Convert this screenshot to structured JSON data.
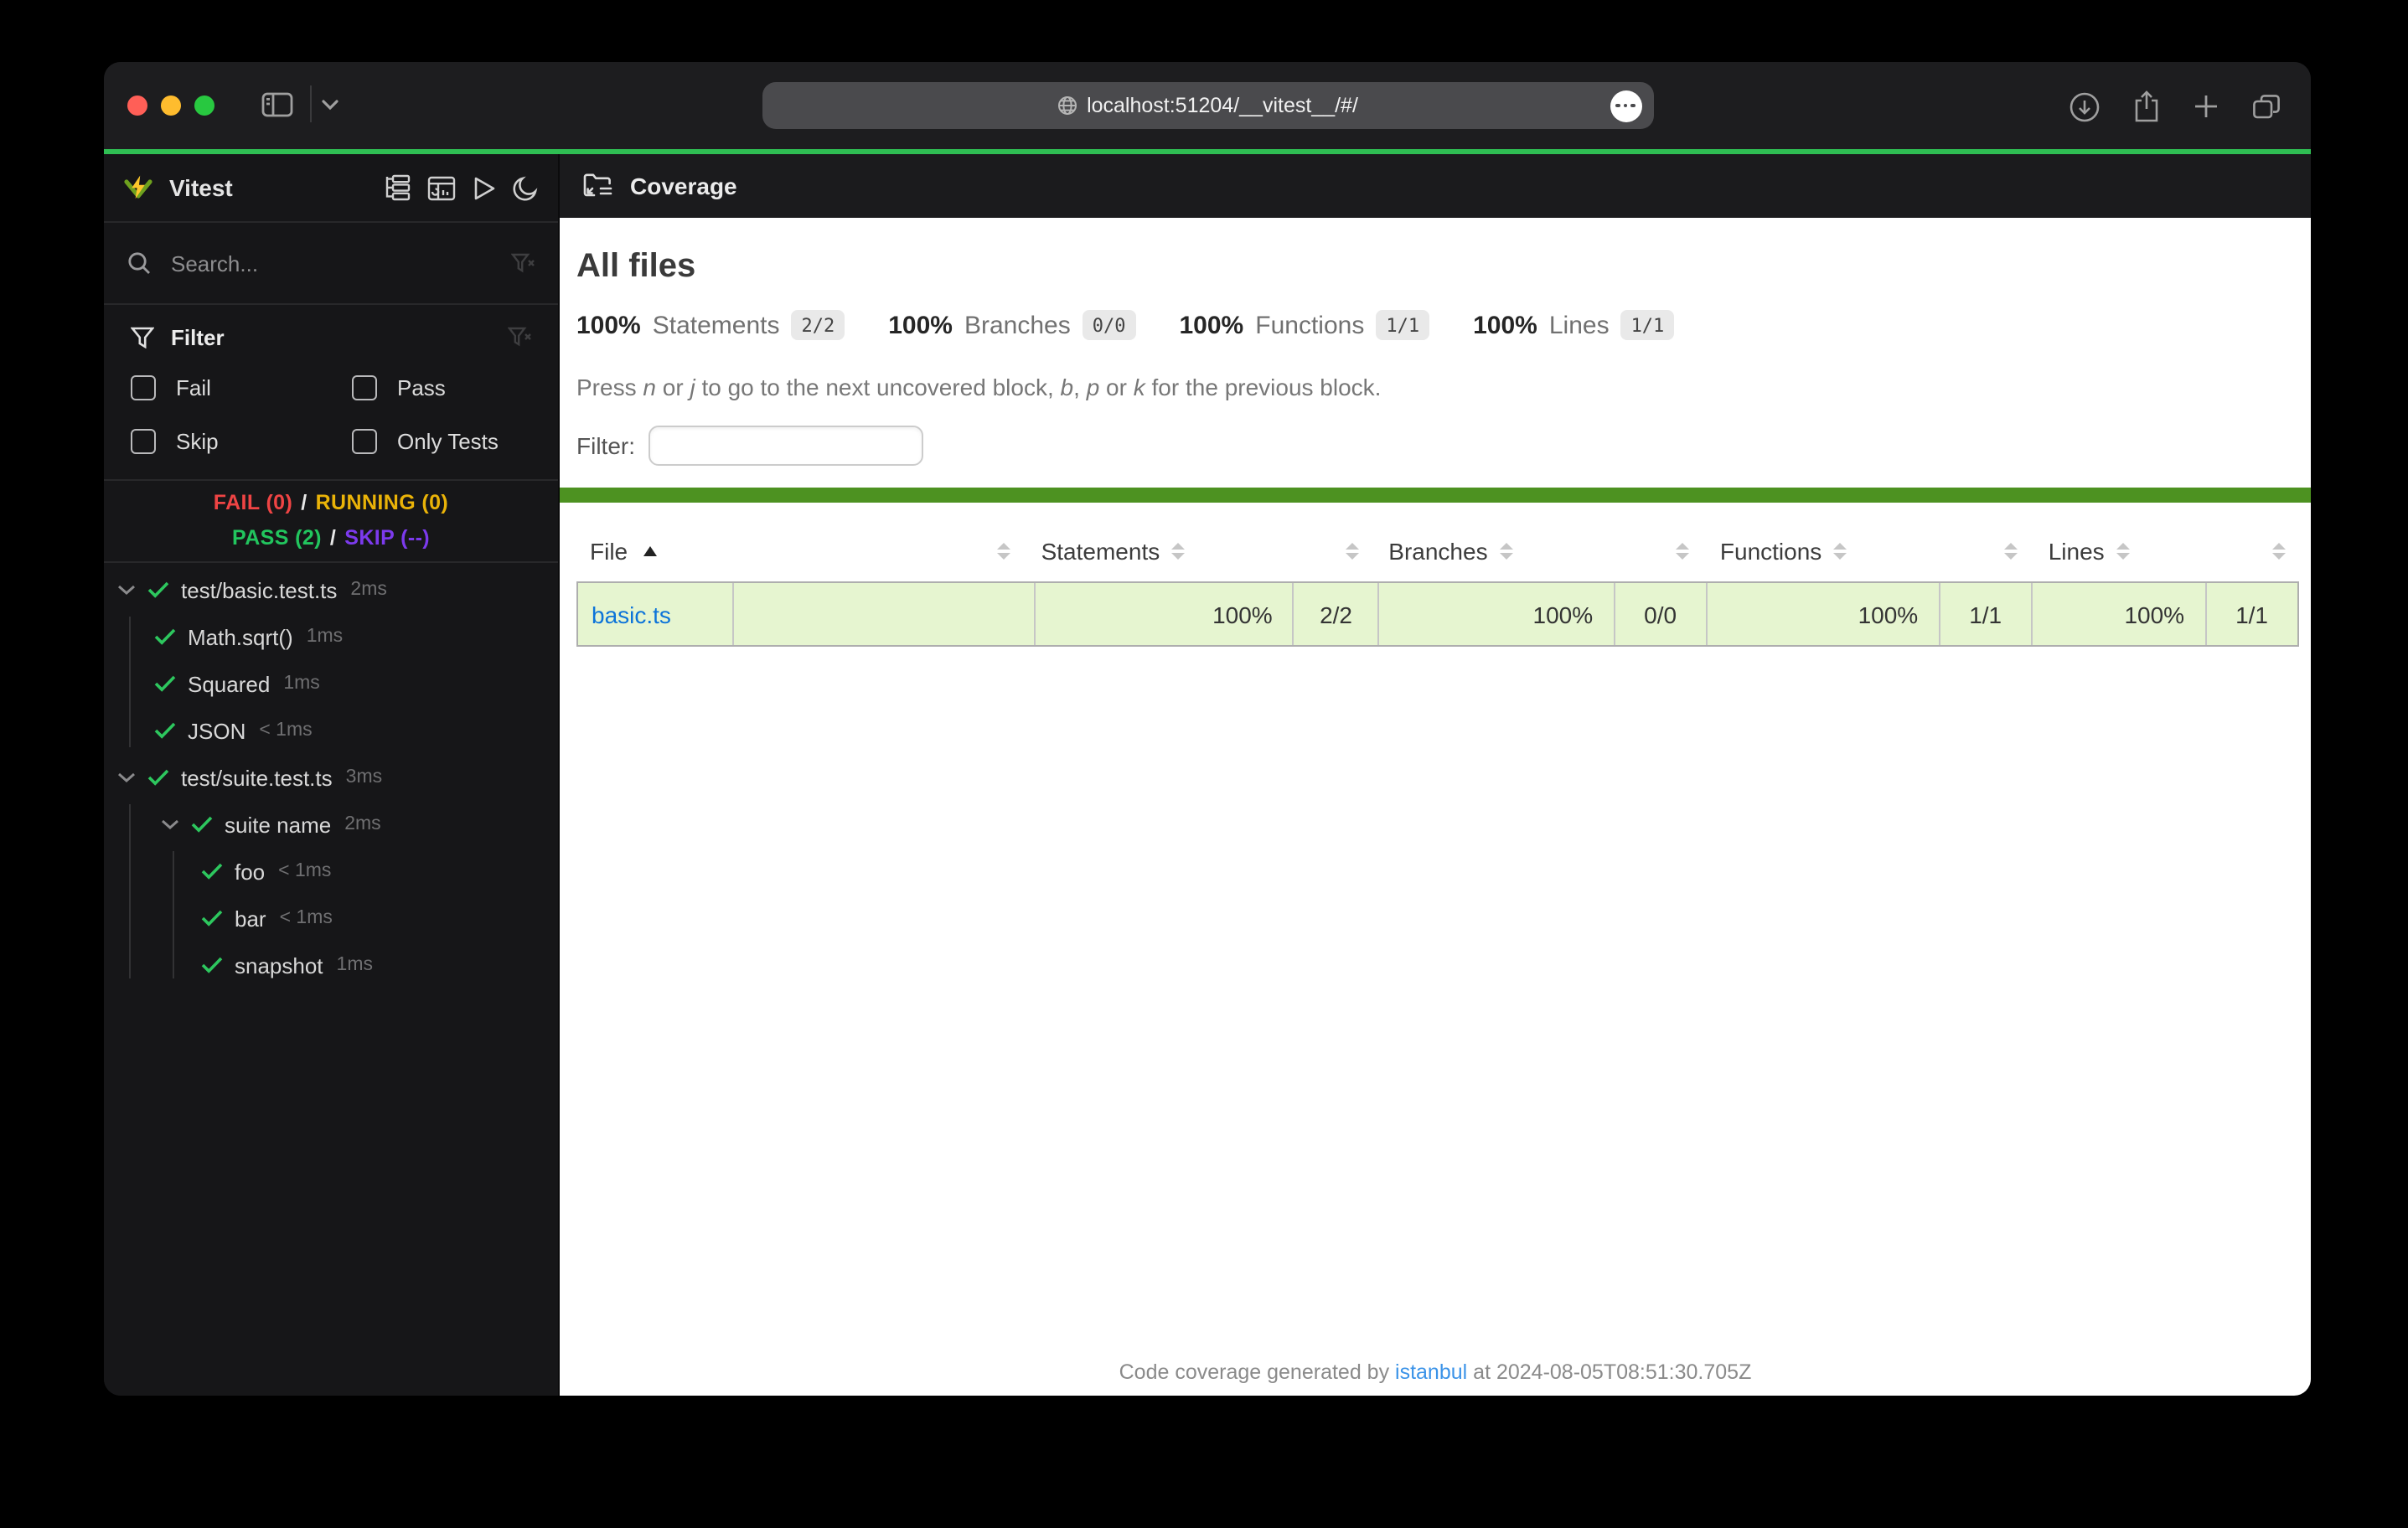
{
  "browser": {
    "url": "localhost:51204/__vitest__/#/"
  },
  "sidebar": {
    "app_title": "Vitest",
    "search_placeholder": "Search...",
    "filter": {
      "title": "Filter",
      "options": [
        "Fail",
        "Pass",
        "Skip",
        "Only Tests"
      ]
    },
    "status": {
      "fail": "FAIL (0)",
      "sep1": "/",
      "running": "RUNNING (0)",
      "pass": "PASS (2)",
      "sep2": "/",
      "skip": "SKIP (--)"
    },
    "tree": [
      {
        "label": "test/basic.test.ts",
        "time": "2ms"
      },
      {
        "label": "Math.sqrt()",
        "time": "1ms"
      },
      {
        "label": "Squared",
        "time": "1ms"
      },
      {
        "label": "JSON",
        "time": "< 1ms"
      },
      {
        "label": "test/suite.test.ts",
        "time": "3ms"
      },
      {
        "label": "suite name",
        "time": "2ms"
      },
      {
        "label": "foo",
        "time": "< 1ms"
      },
      {
        "label": "bar",
        "time": "< 1ms"
      },
      {
        "label": "snapshot",
        "time": "1ms"
      }
    ]
  },
  "main": {
    "page_title": "Coverage",
    "heading": "All files",
    "stats": [
      {
        "pct": "100%",
        "label": "Statements",
        "frac": "2/2"
      },
      {
        "pct": "100%",
        "label": "Branches",
        "frac": "0/0"
      },
      {
        "pct": "100%",
        "label": "Functions",
        "frac": "1/1"
      },
      {
        "pct": "100%",
        "label": "Lines",
        "frac": "1/1"
      }
    ],
    "hint": {
      "p1": "Press ",
      "k1": "n",
      "p2": " or ",
      "k2": "j",
      "p3": " to go to the next uncovered block, ",
      "k3": "b",
      "p4": ", ",
      "k4": "p",
      "p5": " or ",
      "k5": "k",
      "p6": " for the previous block."
    },
    "filter_label": "Filter:",
    "filter_value": "",
    "table": {
      "headers": {
        "file": "File",
        "statements": "Statements",
        "branches": "Branches",
        "functions": "Functions",
        "lines": "Lines"
      },
      "row": {
        "file": "basic.ts",
        "bar_percent": 100,
        "statements_pct": "100%",
        "statements_raw": "2/2",
        "branches_pct": "100%",
        "branches_raw": "0/0",
        "functions_pct": "100%",
        "functions_raw": "1/1",
        "lines_pct": "100%",
        "lines_raw": "1/1"
      }
    },
    "footer": {
      "prefix": "Code coverage generated by ",
      "link_label": "istanbul",
      "suffix": " at 2024-08-05T08:51:30.705Z"
    }
  },
  "colors": {
    "accent_green": "#2fbe53",
    "coverage_bar_green": "#4d9221",
    "coverage_row_bg": "#e6f5d0",
    "link_blue": "#0d74d9",
    "fail_red": "#ef4444",
    "running_yellow": "#eab308",
    "pass_green": "#22c55e",
    "skip_purple": "#7c3aed",
    "check_green": "#2dc75e",
    "traffic_red": "#ff5f57",
    "traffic_yellow": "#febc2e",
    "traffic_green": "#28c840"
  }
}
